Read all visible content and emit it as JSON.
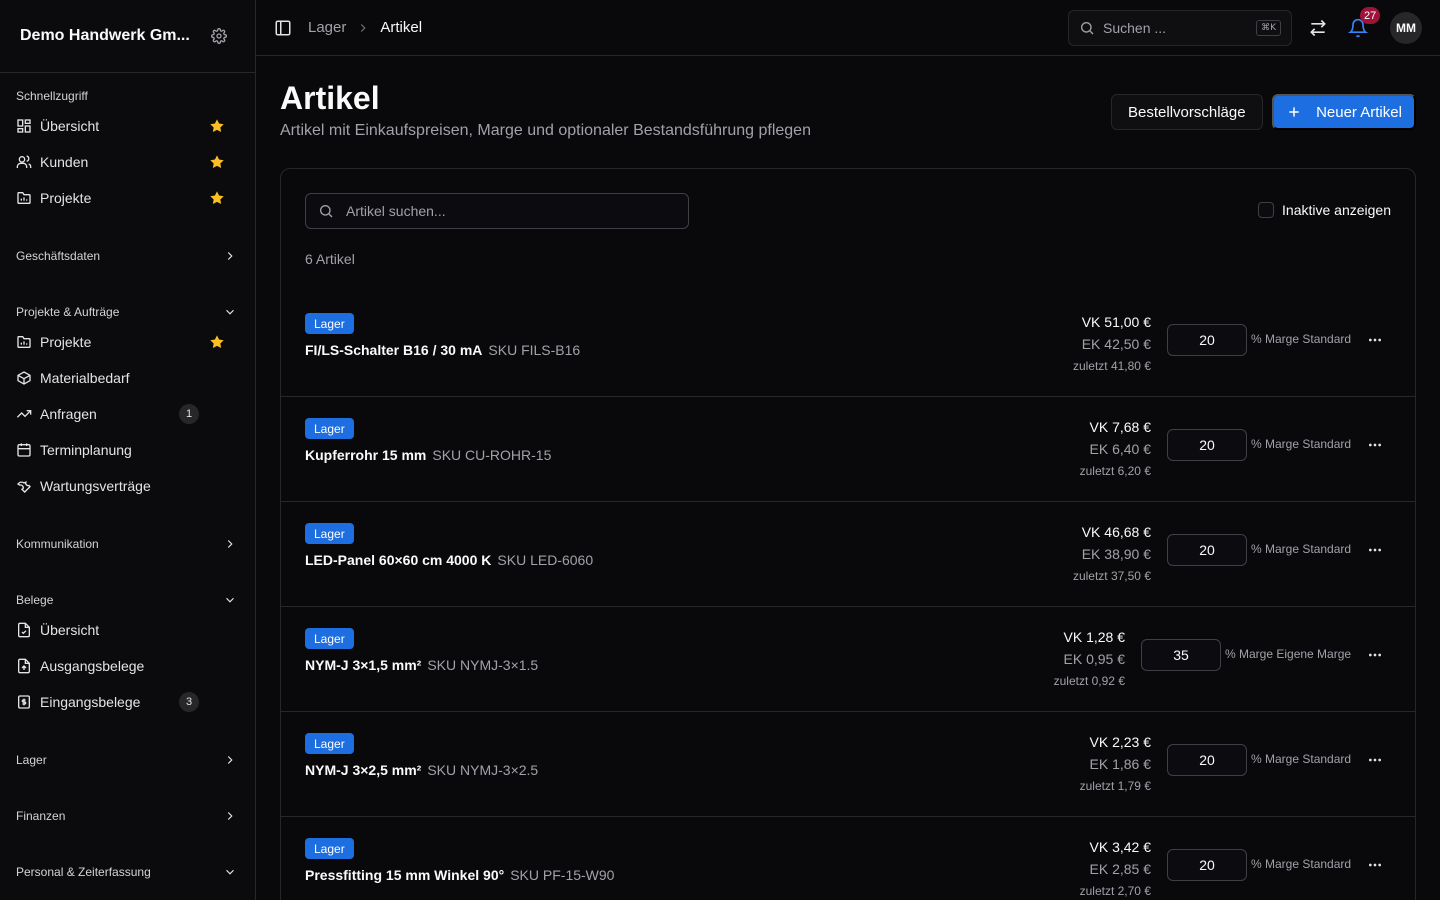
{
  "sidebar": {
    "company": "Demo Handwerk Gm...",
    "groups": {
      "quick": "Schnellzugriff",
      "business": "Geschäftsdaten",
      "projects": "Projekte & Aufträge",
      "communication": "Kommunikation",
      "documents": "Belege",
      "stock": "Lager",
      "finance": "Finanzen",
      "hr": "Personal & Zeiterfassung"
    },
    "quick_items": [
      "Übersicht",
      "Kunden",
      "Projekte"
    ],
    "project_items": [
      "Projekte",
      "Materialbedarf",
      "Anfragen",
      "Terminplanung",
      "Wartungsverträge"
    ],
    "project_counts": {
      "requests": "1"
    },
    "document_items": [
      "Übersicht",
      "Ausgangsbelege",
      "Eingangsbelege"
    ],
    "document_counts": {
      "incoming": "3"
    }
  },
  "topbar": {
    "breadcrumb": [
      "Lager",
      "Artikel"
    ],
    "search_placeholder": "Suchen ...",
    "shortcut": "⌘K",
    "notifications": "27",
    "avatar": "MM"
  },
  "page": {
    "title": "Artikel",
    "subtitle": "Artikel mit Einkaufspreisen, Marge und optionaler Bestandsführung pflegen",
    "btn_suggestions": "Bestellvorschläge",
    "btn_new": "Neuer Artikel"
  },
  "list": {
    "search_placeholder": "Artikel suchen...",
    "show_inactive": "Inaktive anzeigen",
    "count": "6 Artikel",
    "articles": [
      {
        "badge": "Lager",
        "name": "FI/LS-Schalter B16 / 30 mA",
        "sku": "SKU FILS-B16",
        "vk": "VK 51,00 €",
        "ek": "EK 42,50 €",
        "last": "zuletzt 41,80 €",
        "margin": "20",
        "margin_label": "% Marge Standard"
      },
      {
        "badge": "Lager",
        "name": "Kupferrohr 15 mm",
        "sku": "SKU CU-ROHR-15",
        "vk": "VK 7,68 €",
        "ek": "EK 6,40 €",
        "last": "zuletzt 6,20 €",
        "margin": "20",
        "margin_label": "% Marge Standard"
      },
      {
        "badge": "Lager",
        "name": "LED-Panel 60×60 cm 4000 K",
        "sku": "SKU LED-6060",
        "vk": "VK 46,68 €",
        "ek": "EK 38,90 €",
        "last": "zuletzt 37,50 €",
        "margin": "20",
        "margin_label": "% Marge Standard"
      },
      {
        "badge": "Lager",
        "name": "NYM-J 3×1,5 mm²",
        "sku": "SKU NYMJ-3×1.5",
        "vk": "VK 1,28 €",
        "ek": "EK 0,95 €",
        "last": "zuletzt 0,92 €",
        "margin": "35",
        "margin_label": "% Marge Eigene Marge"
      },
      {
        "badge": "Lager",
        "name": "NYM-J 3×2,5 mm²",
        "sku": "SKU NYMJ-3×2.5",
        "vk": "VK 2,23 €",
        "ek": "EK 1,86 €",
        "last": "zuletzt 1,79 €",
        "margin": "20",
        "margin_label": "% Marge Standard"
      },
      {
        "badge": "Lager",
        "name": "Pressfitting 15 mm Winkel 90°",
        "sku": "SKU PF-15-W90",
        "vk": "VK 3,42 €",
        "ek": "EK 2,85 €",
        "last": "zuletzt 2,70 €",
        "margin": "20",
        "margin_label": "% Marge Standard"
      }
    ]
  },
  "colors": {
    "accent": "#1d6ee0",
    "star": "#fbbf24",
    "notification": "#9f1239"
  }
}
